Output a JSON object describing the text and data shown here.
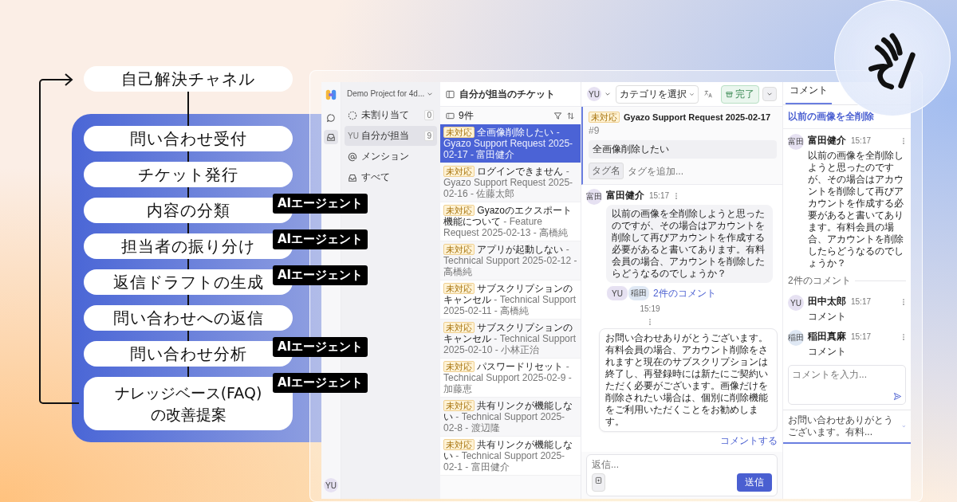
{
  "flow": {
    "top_step": "自己解決チャネル",
    "steps": [
      {
        "label": "問い合わせ受付"
      },
      {
        "label": "チケット発行"
      },
      {
        "label": "内容の分類",
        "badge": "AIエージェント"
      },
      {
        "label": "担当者の振り分け",
        "badge": "AIエージェント"
      },
      {
        "label": "返信ドラフトの生成",
        "badge": "AIエージェント"
      },
      {
        "label": "問い合わせへの返信"
      },
      {
        "label": "問い合わせ分析",
        "badge": "AIエージェント"
      },
      {
        "label": "ナレッジベース(FAQ)の改善提案",
        "badge": "AIエージェント"
      }
    ]
  },
  "app": {
    "rail": {
      "items": [
        {
          "kind": "chat",
          "selected": false
        },
        {
          "kind": "inbox",
          "selected": true
        }
      ],
      "user": "YU"
    },
    "sidebar": {
      "project": "Demo Project for 4d...",
      "items": [
        {
          "kind": "dashed",
          "label": "未割り当て",
          "count": "0",
          "selected": false
        },
        {
          "kind": "avatar",
          "avatar": "YU",
          "label": "自分が担当",
          "count": "9",
          "selected": true
        },
        {
          "kind": "at",
          "label": "メンション",
          "selected": false
        },
        {
          "kind": "inbox",
          "label": "すべて",
          "selected": false
        }
      ]
    },
    "list": {
      "title": "自分が担当のチケット",
      "count": "9件",
      "tickets": [
        {
          "status": "未対応",
          "title": "全画像削除したい",
          "meta": "- Gyazo Support Request 2025-02-17 - 富田健介",
          "selected": true
        },
        {
          "status": "未対応",
          "title": "ログインできません",
          "meta": "- Gyazo Support Request 2025-02-16 - 佐藤太郎",
          "selected": false
        },
        {
          "status": "未対応",
          "title": "Gyazoのエクスポート機能について",
          "meta": "- Feature Request 2025-02-13 - 高橋純",
          "selected": false
        },
        {
          "status": "未対応",
          "title": "アプリが起動しない",
          "meta": "- Technical Support 2025-02-12 - 高橋純",
          "selected": false
        },
        {
          "status": "未対応",
          "title": "サブスクリプションのキャンセル",
          "meta": "- Technical Support 2025-02-11 - 高橋純",
          "selected": false
        },
        {
          "status": "未対応",
          "title": "サブスクリプションのキャンセル",
          "meta": "- Technical Support 2025-02-10 - 小林正治",
          "selected": false
        },
        {
          "status": "未対応",
          "title": "パスワードリセット",
          "meta": "- Technical Support 2025-02-9 - 加藤恵",
          "selected": false
        },
        {
          "status": "未対応",
          "title": "共有リンクが機能しない",
          "meta": "- Technical Support 2025-02-8 - 渡辺隆",
          "selected": false
        },
        {
          "status": "未対応",
          "title": "共有リンクが機能しない",
          "meta": "- Technical Support 2025-02-1 - 富田健介",
          "selected": false
        }
      ]
    },
    "main": {
      "assignee": "YU",
      "category": "カテゴリを選択",
      "done_button": "完了",
      "status": "未対応",
      "title": "Gyazo Support Request 2025-02-17",
      "number": "#9",
      "subject": "全画像削除したい",
      "tag": "タグ名",
      "tag_placeholder": "タグを追加...",
      "message": {
        "avatar": "富田",
        "name": "富田健介",
        "time": "15:17",
        "body": "以前の画像を全削除しようと思ったのですが、その場合はアカウントを削除して再びアカウントを作成する必要があると書いてあります。有料会員の場合、アカウントを削除したらどうなるのでしょうか？",
        "commenters": [
          "YU",
          "稲田"
        ],
        "comments_link": "2件のコメント"
      },
      "reply": {
        "time": "15:19",
        "body": "お問い合わせありがとうございます。有料会員の場合、アカウント削除をされますと現在のサブスクリプションは終了し、再登録時には新たにご契約いただく必要がございます。画像だけを削除されたい場合は、個別に削除機能をご利用いただくことをお勧めします。",
        "comment_link": "コメントする"
      },
      "composer_placeholder": "返信...",
      "send_button": "送信"
    },
    "right": {
      "tab": "コメント",
      "subject": "以前の画像を全削除",
      "thread": {
        "avatar": "富田",
        "name": "富田健介",
        "time": "15:17",
        "body": "以前の画像を全削除しようと思ったのですが、その場合はアカウントを削除して再びアカウントを作成する必要があると書いてあります。有料会員の場合、アカウントを削除したらどうなるのでしょうか？"
      },
      "divider": "2件のコメント",
      "comments": [
        {
          "avatar": "YU",
          "name": "田中太郎",
          "time": "15:17",
          "body": "コメント"
        },
        {
          "avatar": "稲田",
          "name": "稲田真麻",
          "time": "15:17",
          "body": "コメント"
        }
      ],
      "input_placeholder": "コメントを入力...",
      "footer": "お問い合わせありがとうございます。有料..."
    }
  }
}
